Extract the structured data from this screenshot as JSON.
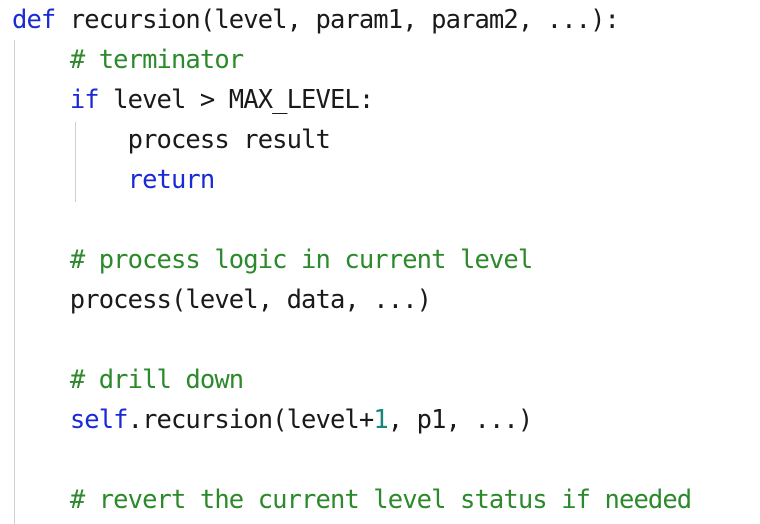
{
  "editor": {
    "lines": [
      [
        {
          "t": "def",
          "c": "kw"
        },
        {
          "t": " recursion(level, param1, param2, ...):",
          "c": "pl"
        }
      ],
      [
        {
          "t": "    ",
          "c": "pl"
        },
        {
          "t": "# terminator",
          "c": "cm"
        }
      ],
      [
        {
          "t": "    ",
          "c": "pl"
        },
        {
          "t": "if",
          "c": "kw"
        },
        {
          "t": " level > MAX_LEVEL:",
          "c": "pl"
        }
      ],
      [
        {
          "t": "        process result",
          "c": "pl"
        }
      ],
      [
        {
          "t": "        ",
          "c": "pl"
        },
        {
          "t": "return",
          "c": "kw"
        }
      ],
      [],
      [
        {
          "t": "    ",
          "c": "pl"
        },
        {
          "t": "# process logic in current level",
          "c": "cm"
        }
      ],
      [
        {
          "t": "    process(level, data, ...)",
          "c": "pl"
        }
      ],
      [],
      [
        {
          "t": "    ",
          "c": "pl"
        },
        {
          "t": "# drill down",
          "c": "cm"
        }
      ],
      [
        {
          "t": "    ",
          "c": "pl"
        },
        {
          "t": "self",
          "c": "kw"
        },
        {
          "t": ".recursion(level+",
          "c": "pl"
        },
        {
          "t": "1",
          "c": "num"
        },
        {
          "t": ", p1, ...)",
          "c": "pl"
        }
      ],
      [],
      [
        {
          "t": "    ",
          "c": "pl"
        },
        {
          "t": "# revert the current level status if needed",
          "c": "cm"
        }
      ]
    ],
    "colors": {
      "keyword": "#1a2bd6",
      "comment": "#2c8a2c",
      "number": "#17877e",
      "plain": "#1a1a1a",
      "indent_guide": "#cfcfcf",
      "background": "#ffffff"
    }
  }
}
